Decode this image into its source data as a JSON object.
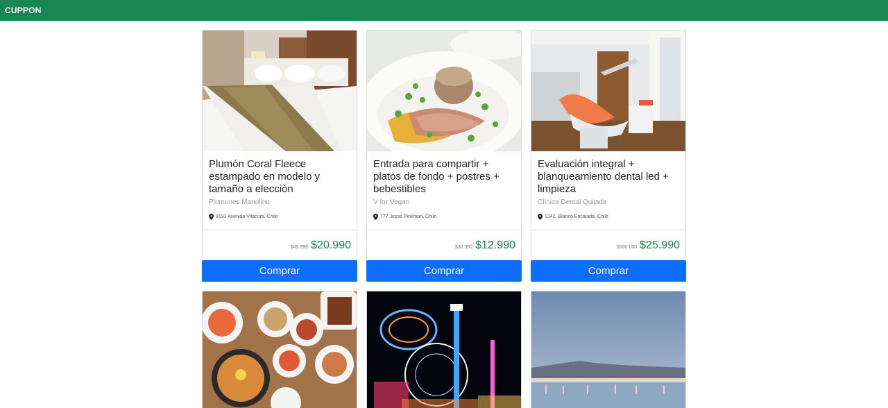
{
  "navbar": {
    "brand": "CUPPON"
  },
  "cards": [
    {
      "title": "Plumón Coral Fleece estampado en modelo y tamaño a elección",
      "merchant": "Plumones Manolino",
      "address": "9191 Avenida Vitacura, Chile",
      "old_price": "$45.990",
      "price": "$20.990",
      "button": "Comprar",
      "image": "hotel-bed-image"
    },
    {
      "title": "Entrada para compartir + platos de fondo + postres + bebestibles",
      "merchant": "V for Vegan",
      "address": "777 Jesse Pinkman, Chile",
      "old_price": "$30.990",
      "price": "$12.990",
      "button": "Comprar",
      "image": "plated-food-image"
    },
    {
      "title": "Evaluación integral + blanqueamiento dental led + limpieza",
      "merchant": "Clínica Dental Quijada",
      "address": "1342, Blanco Encalada, Chile",
      "old_price": "$300.000",
      "price": "$25.990",
      "button": "Comprar",
      "image": "dental-clinic-image"
    }
  ],
  "more_cards": [
    {
      "image": "korean-food-image"
    },
    {
      "image": "amusement-park-image"
    },
    {
      "image": "salt-flat-flamingos-image"
    }
  ],
  "colors": {
    "navbar": "#198754",
    "price": "#198754",
    "button": "#0d6efd"
  },
  "icons": {
    "address": "map-marker-icon"
  }
}
